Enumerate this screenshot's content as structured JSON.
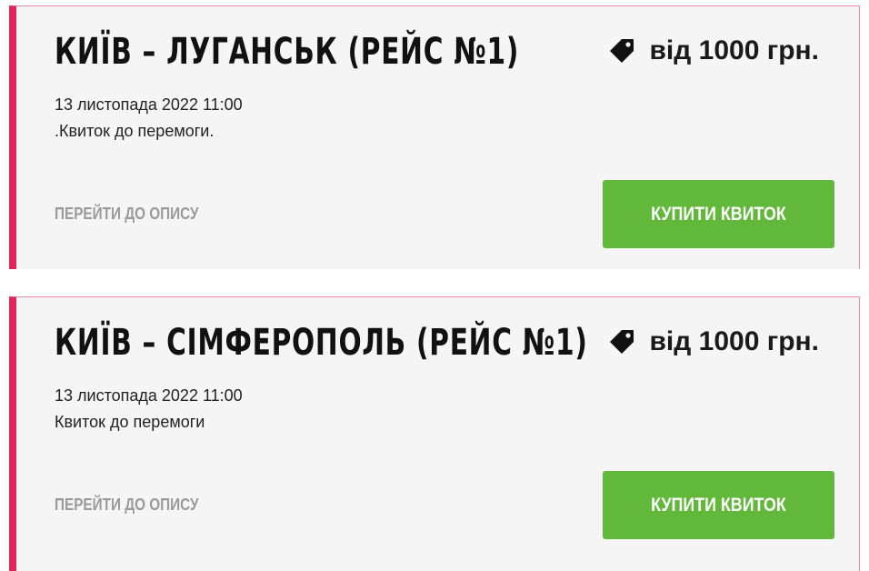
{
  "tickets": [
    {
      "title": "КИЇВ – ЛУГАНСЬК (РЕЙС №1)",
      "price": "від 1000 грн.",
      "date": "13 листопада 2022 11:00",
      "description": ".Квиток до перемоги.",
      "details_link": "ПЕРЕЙТИ ДО ОПИСУ",
      "buy_button": "КУПИТИ КВИТОК"
    },
    {
      "title": "КИЇВ – СІМФЕРОПОЛЬ (РЕЙС №1)",
      "price": "від 1000 грн.",
      "date": "13 листопада 2022 11:00",
      "description": "Квиток до перемоги",
      "details_link": "ПЕРЕЙТИ ДО ОПИСУ",
      "buy_button": "КУПИТИ КВИТОК"
    }
  ],
  "colors": {
    "accent_border": "#e0245e",
    "card_background": "#f5f5f5",
    "buy_button": "#62b83a",
    "link": "#9a9a9a"
  },
  "icons": {
    "price": "price-tag-icon"
  }
}
